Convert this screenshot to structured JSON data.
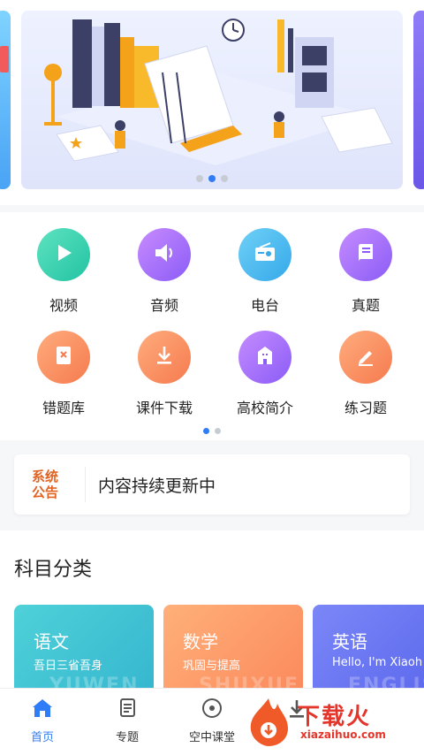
{
  "banner": {
    "dots": 3,
    "active_dot": 1
  },
  "grid": {
    "items": [
      {
        "label": "视频",
        "icon": "play-icon",
        "color_from": "#5ee3c0",
        "color_to": "#22c3a3"
      },
      {
        "label": "音频",
        "icon": "speaker-icon",
        "color_from": "#c88bff",
        "color_to": "#8b5cf6"
      },
      {
        "label": "电台",
        "icon": "radio-icon",
        "color_from": "#6fd0f6",
        "color_to": "#35a9ea"
      },
      {
        "label": "真题",
        "icon": "book-icon",
        "color_from": "#c58cff",
        "color_to": "#8b5cf6"
      },
      {
        "label": "错题库",
        "icon": "error-book-icon",
        "color_from": "#ffac7d",
        "color_to": "#f57b4f"
      },
      {
        "label": "课件下载",
        "icon": "download-icon",
        "color_from": "#ffac7d",
        "color_to": "#f57b4f"
      },
      {
        "label": "高校简介",
        "icon": "building-icon",
        "color_from": "#c58cff",
        "color_to": "#8b5cf6"
      },
      {
        "label": "练习题",
        "icon": "pencil-icon",
        "color_from": "#ffac7d",
        "color_to": "#f57b4f"
      }
    ],
    "page_dots": 2,
    "active_page": 0
  },
  "notice": {
    "logo_line1": "系统",
    "logo_line2": "公告",
    "text": "内容持续更新中"
  },
  "subjects": {
    "title": "科目分类",
    "cards": [
      {
        "name": "语文",
        "desc": "吾日三省吾身",
        "watermark": "YUWEN",
        "color_from": "#4fd1d9",
        "color_to": "#36b7cf"
      },
      {
        "name": "数学",
        "desc": "巩固与提高",
        "watermark": "SHUXUE",
        "color_from": "#ffb07a",
        "color_to": "#fb8a5c"
      },
      {
        "name": "英语",
        "desc": "Hello, I'm Xiaoh",
        "watermark": "ENGLISH",
        "color_from": "#7b87f7",
        "color_to": "#5a67ec"
      }
    ]
  },
  "tabbar": {
    "tabs": [
      {
        "label": "首页",
        "icon": "home-icon",
        "active": true
      },
      {
        "label": "专题",
        "icon": "document-icon",
        "active": false
      },
      {
        "label": "空中课堂",
        "icon": "disc-icon",
        "active": false
      },
      {
        "label": "",
        "icon": "download-icon",
        "active": false
      }
    ]
  },
  "watermark": {
    "title": "下载火",
    "subtitle": "xiazaihuo.com"
  }
}
